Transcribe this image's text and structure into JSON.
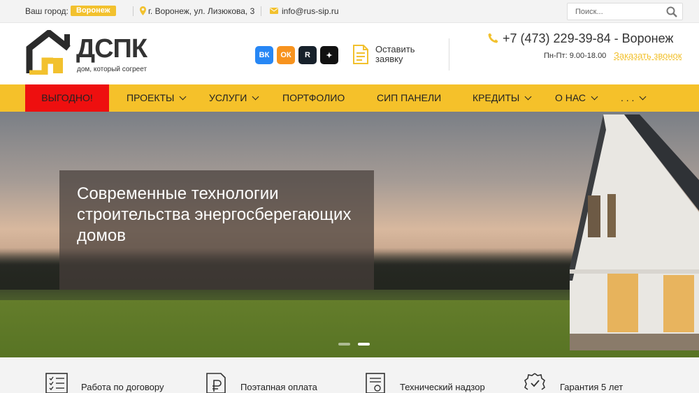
{
  "topbar": {
    "city_label": "Ваш город:",
    "city": "Воронеж",
    "address": "г. Воронеж, ул. Лизюкова, 3",
    "email": "info@rus-sip.ru",
    "search_placeholder": "Поиск..."
  },
  "header": {
    "logo_text": "ДСПК",
    "logo_tagline": "дом, который согреет",
    "socials": [
      "ВК",
      "ОК",
      "R",
      "✦"
    ],
    "request_label": "Оставить заявку",
    "phone": "+7 (473) 229-39-84 - Воронеж",
    "hours": "Пн-Пт: 9.00-18.00",
    "callback": "Заказать звонок"
  },
  "nav": {
    "items": [
      {
        "label": "ВЫГОДНО!"
      },
      {
        "label": "ПРОЕКТЫ"
      },
      {
        "label": "УСЛУГИ"
      },
      {
        "label": "ПОРТФОЛИО"
      },
      {
        "label": "СИП ПАНЕЛИ"
      },
      {
        "label": "КРЕДИТЫ"
      },
      {
        "label": "О НАС"
      },
      {
        "label": ". . ."
      }
    ]
  },
  "hero": {
    "title": "Современные технологии строительства энергосберегающих домов",
    "slides": 2,
    "active_slide": 2
  },
  "features": {
    "items": [
      {
        "label": "Работа по договору"
      },
      {
        "label": "Поэтапная оплата"
      },
      {
        "label": "Технический надзор"
      },
      {
        "label": "Гарантия 5 лет"
      }
    ]
  },
  "colors": {
    "accent": "#f5c12a",
    "promo": "#ee0f0f",
    "badge": "#f2c12e"
  }
}
